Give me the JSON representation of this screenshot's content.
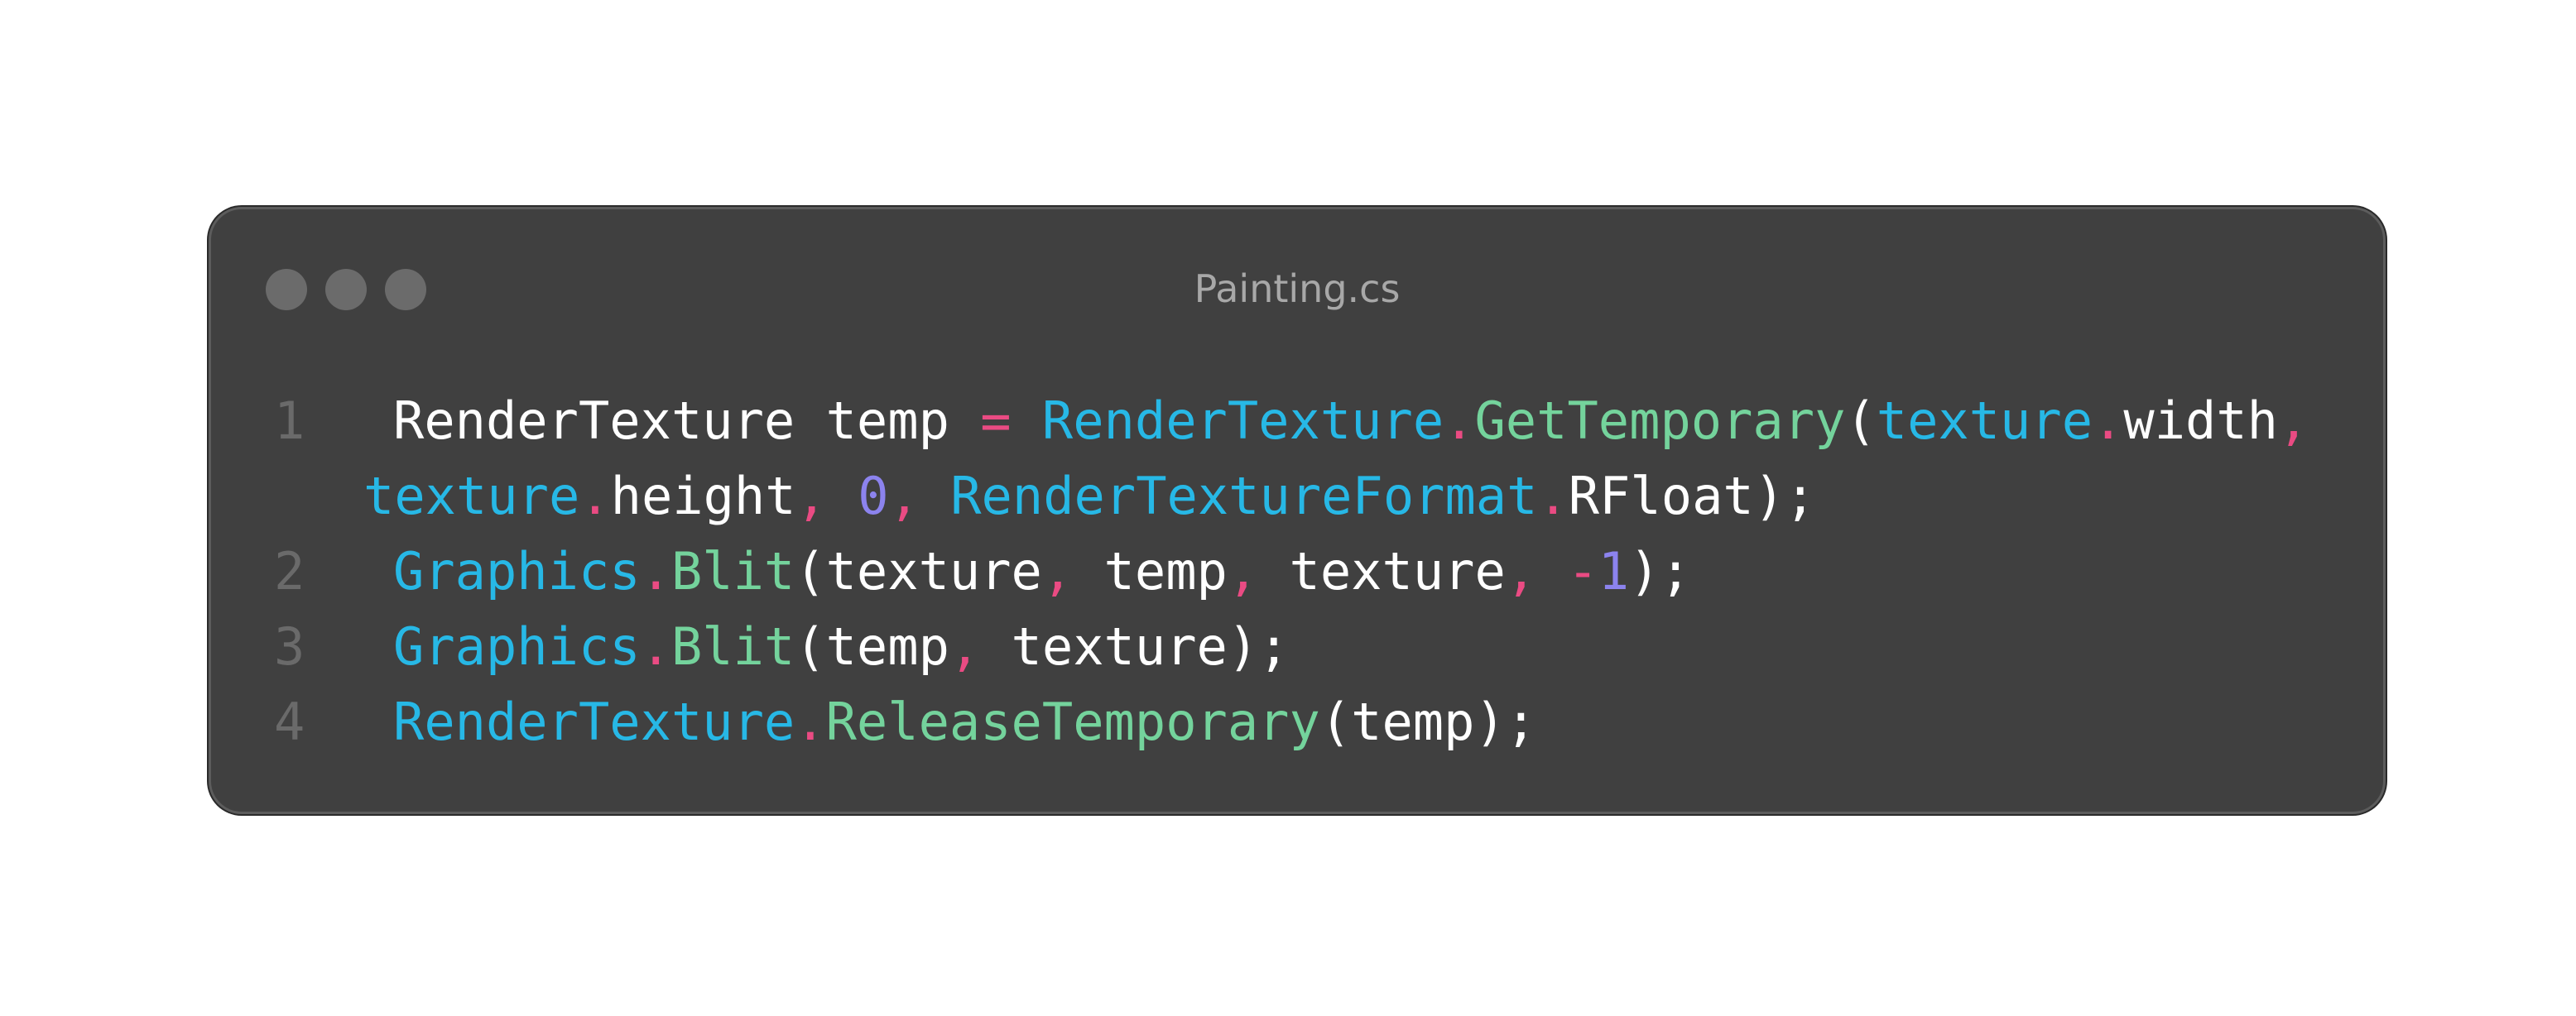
{
  "window": {
    "title": "Painting.cs",
    "traffic_lights": [
      "window-dot",
      "window-dot",
      "window-dot"
    ]
  },
  "code": {
    "language": "csharp",
    "rows": [
      {
        "gutter": "1",
        "tokens": [
          {
            "t": "RenderTexture",
            "k": "plain"
          },
          {
            "t": " temp ",
            "k": "plain"
          },
          {
            "t": "=",
            "k": "op"
          },
          {
            "t": " ",
            "k": "plain"
          },
          {
            "t": "RenderTexture",
            "k": "type"
          },
          {
            "t": ".",
            "k": "op"
          },
          {
            "t": "GetTemporary",
            "k": "fn"
          },
          {
            "t": "(",
            "k": "plain"
          },
          {
            "t": "texture",
            "k": "type"
          },
          {
            "t": ".",
            "k": "op"
          },
          {
            "t": "width",
            "k": "plain"
          },
          {
            "t": ",",
            "k": "op"
          }
        ]
      },
      {
        "gutter": "",
        "wrap": true,
        "tokens": [
          {
            "t": "texture",
            "k": "type"
          },
          {
            "t": ".",
            "k": "op"
          },
          {
            "t": "height",
            "k": "plain"
          },
          {
            "t": ",",
            "k": "op"
          },
          {
            "t": " ",
            "k": "plain"
          },
          {
            "t": "0",
            "k": "num"
          },
          {
            "t": ",",
            "k": "op"
          },
          {
            "t": " ",
            "k": "plain"
          },
          {
            "t": "RenderTextureFormat",
            "k": "type"
          },
          {
            "t": ".",
            "k": "op"
          },
          {
            "t": "RFloat);",
            "k": "plain"
          }
        ]
      },
      {
        "gutter": "2",
        "tokens": [
          {
            "t": "Graphics",
            "k": "type"
          },
          {
            "t": ".",
            "k": "op"
          },
          {
            "t": "Blit",
            "k": "fn"
          },
          {
            "t": "(texture",
            "k": "plain"
          },
          {
            "t": ",",
            "k": "op"
          },
          {
            "t": " temp",
            "k": "plain"
          },
          {
            "t": ",",
            "k": "op"
          },
          {
            "t": " texture",
            "k": "plain"
          },
          {
            "t": ",",
            "k": "op"
          },
          {
            "t": " ",
            "k": "plain"
          },
          {
            "t": "-",
            "k": "op"
          },
          {
            "t": "1",
            "k": "num"
          },
          {
            "t": ");",
            "k": "plain"
          }
        ]
      },
      {
        "gutter": "3",
        "tokens": [
          {
            "t": "Graphics",
            "k": "type"
          },
          {
            "t": ".",
            "k": "op"
          },
          {
            "t": "Blit",
            "k": "fn"
          },
          {
            "t": "(temp",
            "k": "plain"
          },
          {
            "t": ",",
            "k": "op"
          },
          {
            "t": " texture);",
            "k": "plain"
          }
        ]
      },
      {
        "gutter": "4",
        "tokens": [
          {
            "t": "RenderTexture",
            "k": "type"
          },
          {
            "t": ".",
            "k": "op"
          },
          {
            "t": "ReleaseTemporary",
            "k": "fn"
          },
          {
            "t": "(temp);",
            "k": "plain"
          }
        ]
      }
    ]
  },
  "colors": {
    "window_bg": "#404040",
    "type": "#27b8e6",
    "function": "#74d39c",
    "operator": "#ea4b83",
    "number": "#8c83ee",
    "plain": "#ffffff",
    "line_number": "#6a6a6a",
    "title": "#a8a8a8"
  }
}
